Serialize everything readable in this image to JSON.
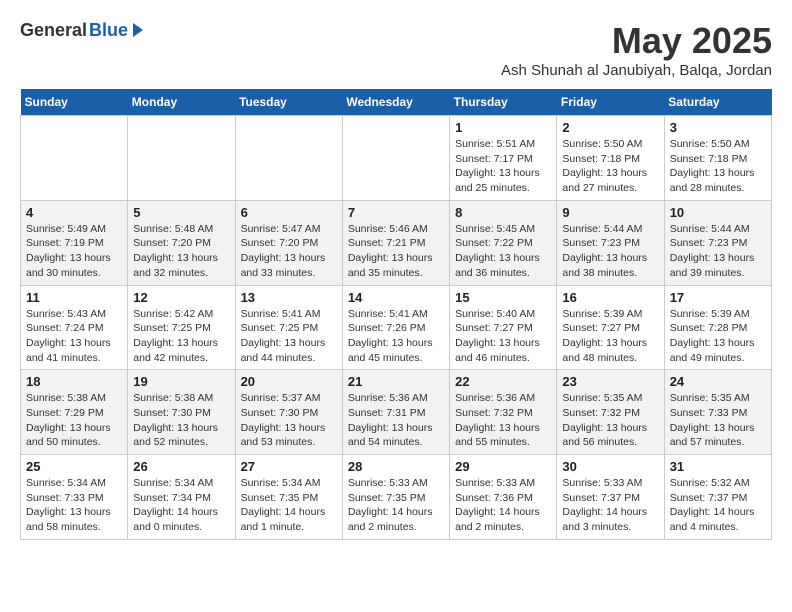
{
  "logo": {
    "general": "General",
    "blue": "Blue"
  },
  "title": "May 2025",
  "location": "Ash Shunah al Janubiyah, Balqa, Jordan",
  "headers": [
    "Sunday",
    "Monday",
    "Tuesday",
    "Wednesday",
    "Thursday",
    "Friday",
    "Saturday"
  ],
  "weeks": [
    [
      {
        "day": "",
        "sunrise": "",
        "sunset": "",
        "daylight": ""
      },
      {
        "day": "",
        "sunrise": "",
        "sunset": "",
        "daylight": ""
      },
      {
        "day": "",
        "sunrise": "",
        "sunset": "",
        "daylight": ""
      },
      {
        "day": "",
        "sunrise": "",
        "sunset": "",
        "daylight": ""
      },
      {
        "day": "1",
        "sunrise": "Sunrise: 5:51 AM",
        "sunset": "Sunset: 7:17 PM",
        "daylight": "Daylight: 13 hours and 25 minutes."
      },
      {
        "day": "2",
        "sunrise": "Sunrise: 5:50 AM",
        "sunset": "Sunset: 7:18 PM",
        "daylight": "Daylight: 13 hours and 27 minutes."
      },
      {
        "day": "3",
        "sunrise": "Sunrise: 5:50 AM",
        "sunset": "Sunset: 7:18 PM",
        "daylight": "Daylight: 13 hours and 28 minutes."
      }
    ],
    [
      {
        "day": "4",
        "sunrise": "Sunrise: 5:49 AM",
        "sunset": "Sunset: 7:19 PM",
        "daylight": "Daylight: 13 hours and 30 minutes."
      },
      {
        "day": "5",
        "sunrise": "Sunrise: 5:48 AM",
        "sunset": "Sunset: 7:20 PM",
        "daylight": "Daylight: 13 hours and 32 minutes."
      },
      {
        "day": "6",
        "sunrise": "Sunrise: 5:47 AM",
        "sunset": "Sunset: 7:20 PM",
        "daylight": "Daylight: 13 hours and 33 minutes."
      },
      {
        "day": "7",
        "sunrise": "Sunrise: 5:46 AM",
        "sunset": "Sunset: 7:21 PM",
        "daylight": "Daylight: 13 hours and 35 minutes."
      },
      {
        "day": "8",
        "sunrise": "Sunrise: 5:45 AM",
        "sunset": "Sunset: 7:22 PM",
        "daylight": "Daylight: 13 hours and 36 minutes."
      },
      {
        "day": "9",
        "sunrise": "Sunrise: 5:44 AM",
        "sunset": "Sunset: 7:23 PM",
        "daylight": "Daylight: 13 hours and 38 minutes."
      },
      {
        "day": "10",
        "sunrise": "Sunrise: 5:44 AM",
        "sunset": "Sunset: 7:23 PM",
        "daylight": "Daylight: 13 hours and 39 minutes."
      }
    ],
    [
      {
        "day": "11",
        "sunrise": "Sunrise: 5:43 AM",
        "sunset": "Sunset: 7:24 PM",
        "daylight": "Daylight: 13 hours and 41 minutes."
      },
      {
        "day": "12",
        "sunrise": "Sunrise: 5:42 AM",
        "sunset": "Sunset: 7:25 PM",
        "daylight": "Daylight: 13 hours and 42 minutes."
      },
      {
        "day": "13",
        "sunrise": "Sunrise: 5:41 AM",
        "sunset": "Sunset: 7:25 PM",
        "daylight": "Daylight: 13 hours and 44 minutes."
      },
      {
        "day": "14",
        "sunrise": "Sunrise: 5:41 AM",
        "sunset": "Sunset: 7:26 PM",
        "daylight": "Daylight: 13 hours and 45 minutes."
      },
      {
        "day": "15",
        "sunrise": "Sunrise: 5:40 AM",
        "sunset": "Sunset: 7:27 PM",
        "daylight": "Daylight: 13 hours and 46 minutes."
      },
      {
        "day": "16",
        "sunrise": "Sunrise: 5:39 AM",
        "sunset": "Sunset: 7:27 PM",
        "daylight": "Daylight: 13 hours and 48 minutes."
      },
      {
        "day": "17",
        "sunrise": "Sunrise: 5:39 AM",
        "sunset": "Sunset: 7:28 PM",
        "daylight": "Daylight: 13 hours and 49 minutes."
      }
    ],
    [
      {
        "day": "18",
        "sunrise": "Sunrise: 5:38 AM",
        "sunset": "Sunset: 7:29 PM",
        "daylight": "Daylight: 13 hours and 50 minutes."
      },
      {
        "day": "19",
        "sunrise": "Sunrise: 5:38 AM",
        "sunset": "Sunset: 7:30 PM",
        "daylight": "Daylight: 13 hours and 52 minutes."
      },
      {
        "day": "20",
        "sunrise": "Sunrise: 5:37 AM",
        "sunset": "Sunset: 7:30 PM",
        "daylight": "Daylight: 13 hours and 53 minutes."
      },
      {
        "day": "21",
        "sunrise": "Sunrise: 5:36 AM",
        "sunset": "Sunset: 7:31 PM",
        "daylight": "Daylight: 13 hours and 54 minutes."
      },
      {
        "day": "22",
        "sunrise": "Sunrise: 5:36 AM",
        "sunset": "Sunset: 7:32 PM",
        "daylight": "Daylight: 13 hours and 55 minutes."
      },
      {
        "day": "23",
        "sunrise": "Sunrise: 5:35 AM",
        "sunset": "Sunset: 7:32 PM",
        "daylight": "Daylight: 13 hours and 56 minutes."
      },
      {
        "day": "24",
        "sunrise": "Sunrise: 5:35 AM",
        "sunset": "Sunset: 7:33 PM",
        "daylight": "Daylight: 13 hours and 57 minutes."
      }
    ],
    [
      {
        "day": "25",
        "sunrise": "Sunrise: 5:34 AM",
        "sunset": "Sunset: 7:33 PM",
        "daylight": "Daylight: 13 hours and 58 minutes."
      },
      {
        "day": "26",
        "sunrise": "Sunrise: 5:34 AM",
        "sunset": "Sunset: 7:34 PM",
        "daylight": "Daylight: 14 hours and 0 minutes."
      },
      {
        "day": "27",
        "sunrise": "Sunrise: 5:34 AM",
        "sunset": "Sunset: 7:35 PM",
        "daylight": "Daylight: 14 hours and 1 minute."
      },
      {
        "day": "28",
        "sunrise": "Sunrise: 5:33 AM",
        "sunset": "Sunset: 7:35 PM",
        "daylight": "Daylight: 14 hours and 2 minutes."
      },
      {
        "day": "29",
        "sunrise": "Sunrise: 5:33 AM",
        "sunset": "Sunset: 7:36 PM",
        "daylight": "Daylight: 14 hours and 2 minutes."
      },
      {
        "day": "30",
        "sunrise": "Sunrise: 5:33 AM",
        "sunset": "Sunset: 7:37 PM",
        "daylight": "Daylight: 14 hours and 3 minutes."
      },
      {
        "day": "31",
        "sunrise": "Sunrise: 5:32 AM",
        "sunset": "Sunset: 7:37 PM",
        "daylight": "Daylight: 14 hours and 4 minutes."
      }
    ]
  ]
}
